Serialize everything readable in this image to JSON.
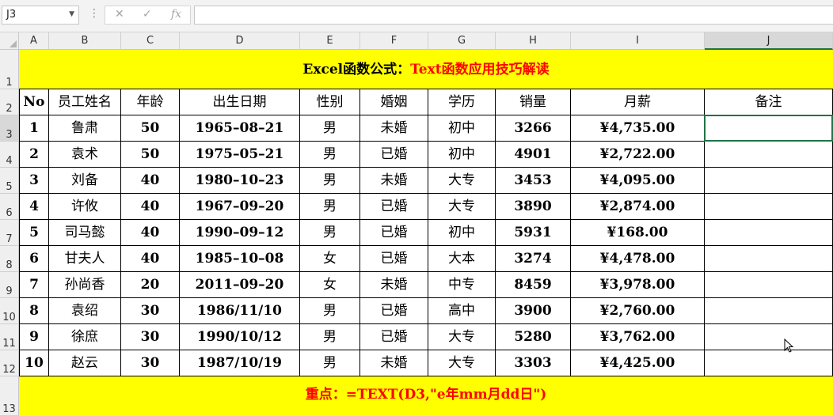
{
  "formula_bar": {
    "name_box": "J3",
    "cancel_icon": "✕",
    "enter_icon": "✓",
    "fx_icon": "fx",
    "formula": ""
  },
  "columns": [
    "A",
    "B",
    "C",
    "D",
    "E",
    "F",
    "G",
    "H",
    "I",
    "J"
  ],
  "rows": [
    "1",
    "2",
    "3",
    "4",
    "5",
    "6",
    "7",
    "8",
    "9",
    "10",
    "11",
    "12",
    "13"
  ],
  "title": {
    "part1": "Excel函数公式：",
    "part2": "Text函数应用技巧解读"
  },
  "headers": [
    "No",
    "员工姓名",
    "年龄",
    "出生日期",
    "性别",
    "婚姻",
    "学历",
    "销量",
    "月薪",
    "备注"
  ],
  "records": [
    [
      "1",
      "鲁肃",
      "50",
      "1965–08–21",
      "男",
      "未婚",
      "初中",
      "3266",
      "¥4,735.00",
      ""
    ],
    [
      "2",
      "袁术",
      "50",
      "1975–05–21",
      "男",
      "已婚",
      "初中",
      "4901",
      "¥2,722.00",
      ""
    ],
    [
      "3",
      "刘备",
      "40",
      "1980–10–23",
      "男",
      "未婚",
      "大专",
      "3453",
      "¥4,095.00",
      ""
    ],
    [
      "4",
      "许攸",
      "40",
      "1967–09–20",
      "男",
      "已婚",
      "大专",
      "3890",
      "¥2,874.00",
      ""
    ],
    [
      "5",
      "司马懿",
      "40",
      "1990–09–12",
      "男",
      "已婚",
      "初中",
      "5931",
      "¥168.00",
      ""
    ],
    [
      "6",
      "甘夫人",
      "40",
      "1985–10–08",
      "女",
      "已婚",
      "大本",
      "3274",
      "¥4,478.00",
      ""
    ],
    [
      "7",
      "孙尚香",
      "20",
      "2011–09–20",
      "女",
      "未婚",
      "中专",
      "8459",
      "¥3,978.00",
      ""
    ],
    [
      "8",
      "袁绍",
      "30",
      "1986/11/10",
      "男",
      "已婚",
      "高中",
      "3900",
      "¥2,760.00",
      ""
    ],
    [
      "9",
      "徐庶",
      "30",
      "1990/10/12",
      "男",
      "已婚",
      "大专",
      "5280",
      "¥3,762.00",
      ""
    ],
    [
      "10",
      "赵云",
      "30",
      "1987/10/19",
      "男",
      "未婚",
      "大专",
      "3303",
      "¥4,425.00",
      ""
    ]
  ],
  "footer": {
    "label": "重点：",
    "formula": "=TEXT(D3,\"e年mm月dd日\")"
  },
  "colors": {
    "highlight": "#ffff00",
    "title_red": "#ff0000",
    "footer_red": "#ff0000",
    "selection_green": "#217346"
  },
  "selected_cell": "J3"
}
